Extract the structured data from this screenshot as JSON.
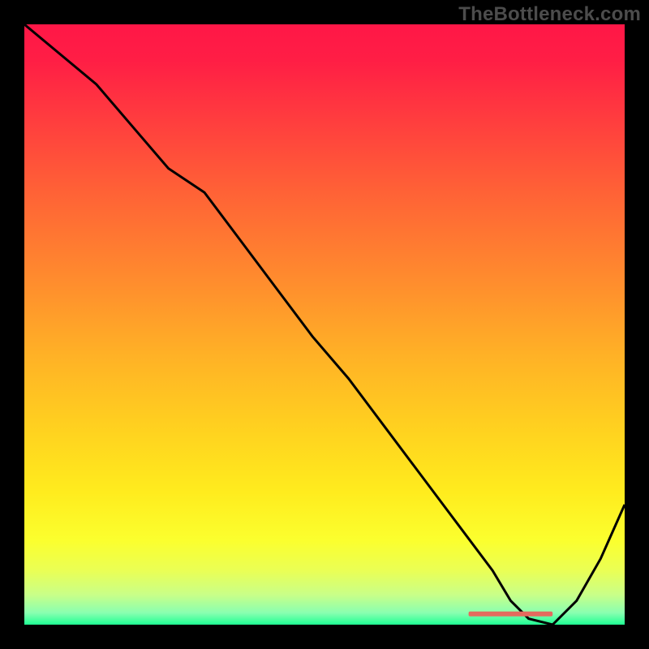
{
  "watermark": "TheBottleneck.com",
  "chart_data": {
    "type": "line",
    "title": "",
    "xlabel": "",
    "ylabel": "",
    "xlim": [
      0,
      100
    ],
    "ylim": [
      0,
      100
    ],
    "grid": false,
    "legend": false,
    "x": [
      0,
      6,
      12,
      18,
      24,
      30,
      36,
      42,
      48,
      54,
      60,
      66,
      72,
      78,
      81,
      84,
      88,
      92,
      96,
      100
    ],
    "values": [
      100,
      95,
      90,
      83,
      76,
      72,
      64,
      56,
      48,
      41,
      33,
      25,
      17,
      9,
      4,
      1,
      0,
      4,
      11,
      20
    ],
    "marker_band": {
      "x_start": 74,
      "x_end": 88,
      "y": 1.8
    },
    "gradient_stops": [
      {
        "offset": 0.0,
        "color": "#ff1747"
      },
      {
        "offset": 0.06,
        "color": "#ff1e45"
      },
      {
        "offset": 0.15,
        "color": "#ff3a3f"
      },
      {
        "offset": 0.28,
        "color": "#ff6236"
      },
      {
        "offset": 0.42,
        "color": "#ff8a2e"
      },
      {
        "offset": 0.55,
        "color": "#ffb126"
      },
      {
        "offset": 0.68,
        "color": "#ffd31f"
      },
      {
        "offset": 0.78,
        "color": "#ffec1e"
      },
      {
        "offset": 0.86,
        "color": "#fbff2e"
      },
      {
        "offset": 0.91,
        "color": "#eaff55"
      },
      {
        "offset": 0.95,
        "color": "#c9ff88"
      },
      {
        "offset": 0.98,
        "color": "#8affb0"
      },
      {
        "offset": 1.0,
        "color": "#1fff94"
      }
    ],
    "line_color": "#000000",
    "marker_color": "#e46a5e"
  }
}
